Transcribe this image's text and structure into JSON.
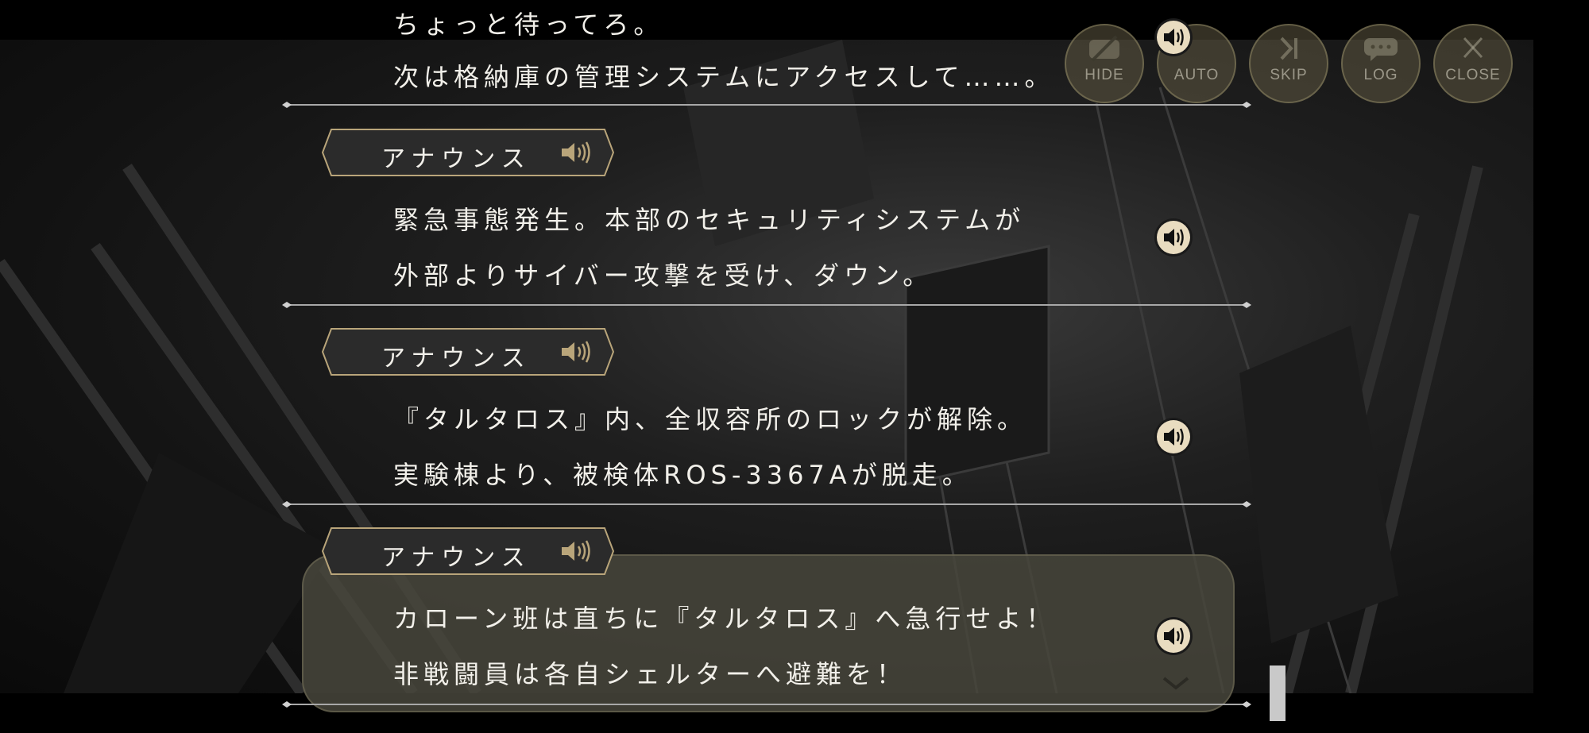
{
  "log": {
    "entries": [
      {
        "speaker": "",
        "lines": [
          "ちょっと待ってろ。",
          "次は格納庫の管理システムにアクセスして……。"
        ]
      },
      {
        "speaker": "アナウンス",
        "lines": [
          "緊急事態発生。本部のセキュリティシステムが",
          "外部よりサイバー攻撃を受け、ダウン。"
        ]
      },
      {
        "speaker": "アナウンス",
        "lines": [
          "『タルタロス』内、全収容所のロックが解除。",
          "実験棟より、被検体ROS-3367Aが脱走。"
        ]
      },
      {
        "speaker": "アナウンス",
        "lines": [
          "カローン班は直ちに『タルタロス』へ急行せよ！",
          "非戦闘員は各自シェルターへ避難を！"
        ]
      }
    ]
  },
  "toolbar": {
    "hide_label": "HIDE",
    "auto_label": "AUTO",
    "skip_label": "SKIP",
    "log_label": "LOG",
    "close_label": "CLOSE"
  },
  "icons": {
    "voice": "speaker-icon",
    "hide": "eye-slash-icon",
    "skip": "skip-forward-icon",
    "log": "chat-bubble-icon",
    "close": "close-icon"
  },
  "colors": {
    "gold": "#b9a57a",
    "text": "#f2f0ea",
    "plate_fill": "#2b2b2b"
  }
}
